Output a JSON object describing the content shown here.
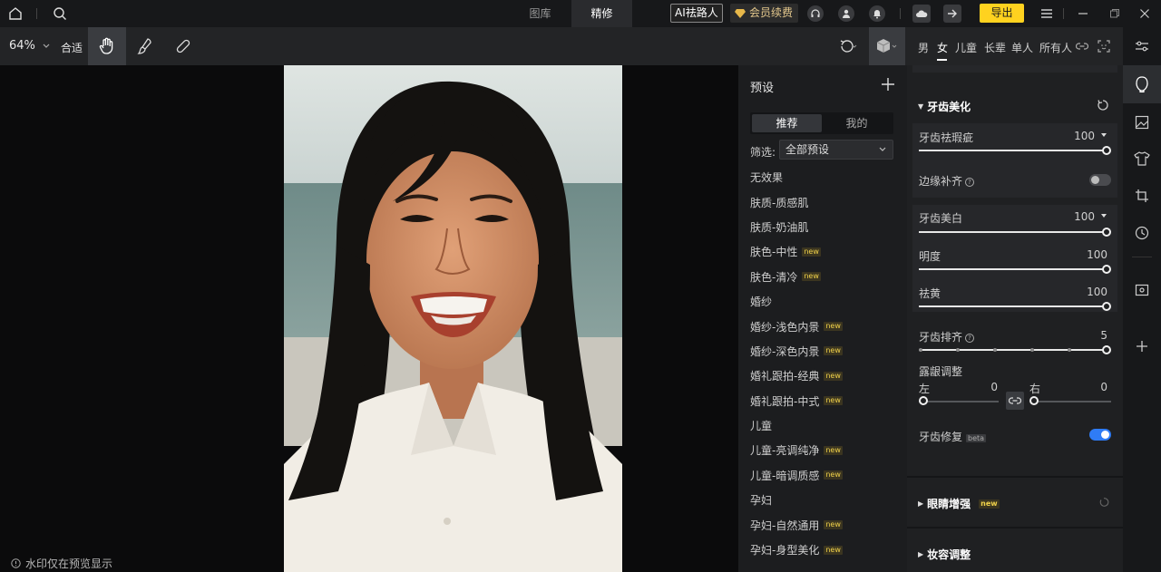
{
  "top_bar": {
    "tabs": [
      {
        "label": "图库",
        "active": false
      },
      {
        "label": "精修",
        "active": true
      }
    ],
    "ai_badge": "AI祛路人",
    "vip_label": "会员续费",
    "export_label": "导出"
  },
  "toolbar": {
    "zoom": "64%",
    "fit_label": "合适",
    "gender_tabs": [
      "男",
      "女",
      "儿童",
      "长辈",
      "单人",
      "所有人"
    ],
    "gender_active": "女"
  },
  "canvas": {
    "watermark_note": "水印仅在预览显示"
  },
  "presets": {
    "title": "预设",
    "segments": [
      "推荐",
      "我的"
    ],
    "segment_active": "推荐",
    "filter_label": "筛选:",
    "filter_value": "全部预设",
    "items": [
      {
        "label": "无效果",
        "new": false
      },
      {
        "label": "肤质-质感肌",
        "new": false
      },
      {
        "label": "肤质-奶油肌",
        "new": false
      },
      {
        "label": "肤色-中性",
        "new": true
      },
      {
        "label": "肤色-清冷",
        "new": true
      },
      {
        "label": "婚纱",
        "new": false
      },
      {
        "label": "婚纱-浅色内景",
        "new": true
      },
      {
        "label": "婚纱-深色内景",
        "new": true
      },
      {
        "label": "婚礼跟拍-经典",
        "new": true
      },
      {
        "label": "婚礼跟拍-中式",
        "new": true
      },
      {
        "label": "儿童",
        "new": false
      },
      {
        "label": "儿童-亮调纯净",
        "new": true
      },
      {
        "label": "儿童-暗调质感",
        "new": true
      },
      {
        "label": "孕妇",
        "new": false
      },
      {
        "label": "孕妇-自然通用",
        "new": true
      },
      {
        "label": "孕妇-身型美化",
        "new": true
      }
    ],
    "new_tag": "new"
  },
  "adjust": {
    "section_teeth": "牙齿美化",
    "teeth_blemish": {
      "label": "牙齿祛瑕疵",
      "value": 100,
      "level": 1.0
    },
    "edge_fill": {
      "label": "边缘补齐",
      "on": false
    },
    "teeth_whiten": {
      "label": "牙齿美白",
      "value": 100,
      "level": 1.0
    },
    "brightness": {
      "label": "明度",
      "value": 100,
      "level": 1.0
    },
    "de_yellow": {
      "label": "祛黄",
      "value": 100,
      "level": 1.0
    },
    "teeth_align": {
      "label": "牙齿排齐",
      "value": 5,
      "level": 1.0
    },
    "gum": {
      "label": "露龈调整",
      "left_label": "左",
      "left_value": 0,
      "right_label": "右",
      "right_value": 0
    },
    "teeth_repair": {
      "label": "牙齿修复",
      "tag": "beta",
      "on": true
    },
    "section_eyes": "眼睛增强",
    "section_makeup": "妆容调整",
    "accent": "#2f7cf6"
  }
}
